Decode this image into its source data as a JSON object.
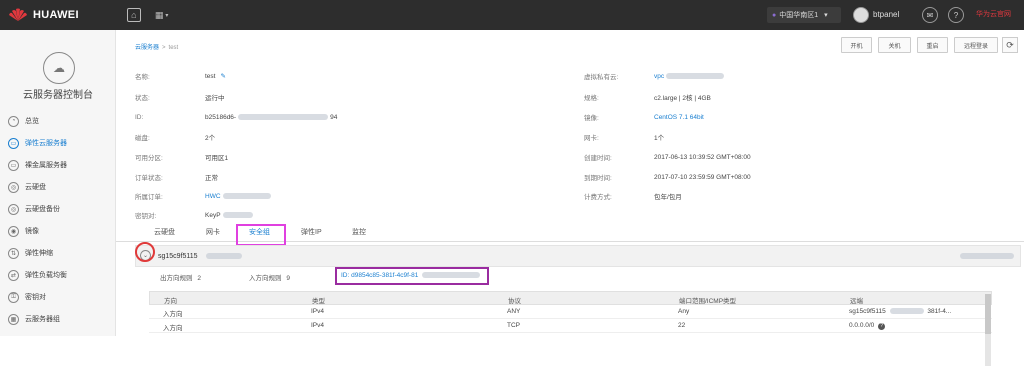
{
  "topbar": {
    "brand": "HUAWEI",
    "region": "中国华南区1",
    "username": "btpanel",
    "brand_link": "华为云官网",
    "colors": {
      "bg": "#2d2d2d",
      "brand_red": "#e0383e"
    }
  },
  "sidebar": {
    "title": "云服务器控制台",
    "items": [
      {
        "label": "总览",
        "icon": "overview-icon",
        "active": false
      },
      {
        "label": "弹性云服务器",
        "icon": "ecs-icon",
        "active": true
      },
      {
        "label": "裸金属服务器",
        "icon": "bms-icon",
        "active": false
      },
      {
        "label": "云硬盘",
        "icon": "evs-icon",
        "active": false
      },
      {
        "label": "云硬盘备份",
        "icon": "backup-icon",
        "active": false
      },
      {
        "label": "镜像",
        "icon": "image-icon",
        "active": false
      },
      {
        "label": "弹性伸缩",
        "icon": "autoscale-icon",
        "active": false
      },
      {
        "label": "弹性负载均衡",
        "icon": "elb-icon",
        "active": false
      },
      {
        "label": "密钥对",
        "icon": "keypair-icon",
        "active": false
      },
      {
        "label": "云服务器组",
        "icon": "group-icon",
        "active": false
      }
    ]
  },
  "breadcrumb": {
    "root": "云服务器",
    "sep": ">",
    "current": "test"
  },
  "actions": {
    "start": "开机",
    "stop": "关机",
    "restart": "重启",
    "remote": "远程登录"
  },
  "details": {
    "left": [
      {
        "label": "名称:",
        "value": "test"
      },
      {
        "label": "状态:",
        "value": "运行中"
      },
      {
        "label": "ID:",
        "value": "b25186d6-",
        "tail": "94"
      },
      {
        "label": "磁盘:",
        "value": "2个"
      },
      {
        "label": "可用分区:",
        "value": "可用区1"
      },
      {
        "label": "订单状态:",
        "value": "正常"
      },
      {
        "label": "所属订单:",
        "value": "HWC"
      },
      {
        "label": "密钥对:",
        "value": "KeyP"
      }
    ],
    "right": [
      {
        "label": "虚拟私有云:",
        "value": "vpc"
      },
      {
        "label": "规格:",
        "value": "c2.large | 2核 | 4GB"
      },
      {
        "label": "镜像:",
        "value": "CentOS 7.1 64bit"
      },
      {
        "label": "网卡:",
        "value": "1个"
      },
      {
        "label": "创建时间:",
        "value": "2017-06-13 10:39:52 GMT+08:00"
      },
      {
        "label": "到期时间:",
        "value": "2017-07-10 23:59:59 GMT+08:00"
      },
      {
        "label": "计费方式:",
        "value": "包年/包月"
      }
    ]
  },
  "tabs": [
    "云硬盘",
    "网卡",
    "安全组",
    "弹性IP",
    "监控"
  ],
  "security_group": {
    "name": "sg15c9f5115",
    "outbound_label": "出方向规则",
    "outbound_count": "2",
    "inbound_label": "入方向规则",
    "inbound_count": "9",
    "id_label": "ID: d9854c85-381f-4c9f-81",
    "columns": [
      "方向",
      "类型",
      "协议",
      "端口范围/ICMP类型",
      "远端"
    ],
    "rows": [
      [
        "入方向",
        "IPv4",
        "ANY",
        "Any",
        "sg15c9f5115",
        "381f-4..."
      ],
      [
        "入方向",
        "IPv4",
        "TCP",
        "22",
        "0.0.0.0/0",
        ""
      ]
    ]
  }
}
